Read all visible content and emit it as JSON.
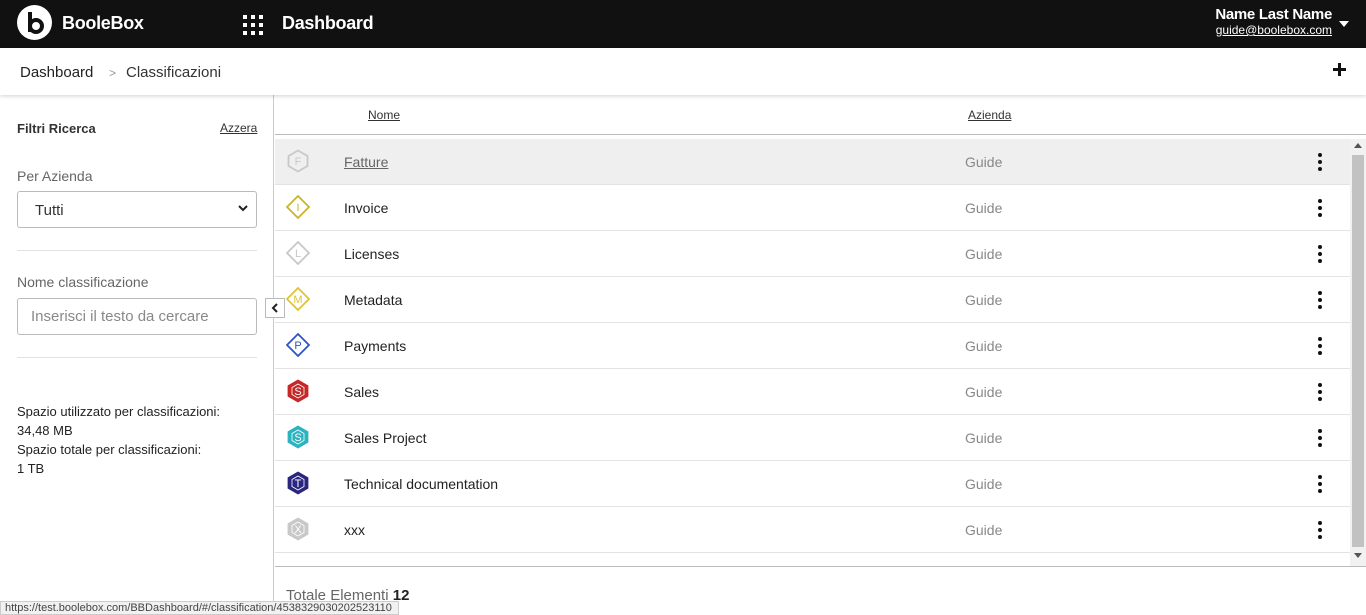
{
  "header": {
    "brand": "BooleBox",
    "title": "Dashboard",
    "user_name": "Name Last Name",
    "user_email": "guide@boolebox.com"
  },
  "breadcrumb": {
    "items": [
      "Dashboard",
      "Classificazioni"
    ],
    "separator": ">"
  },
  "filters": {
    "title": "Filtri Ricerca",
    "reset_label": "Azzera",
    "company_label": "Per Azienda",
    "company_value": "Tutti",
    "name_label": "Nome classificazione",
    "name_placeholder": "Inserisci il testo da cercare",
    "space_used_label": "Spazio utilizzato per classificazioni:",
    "space_used_value": "34,48 MB",
    "space_total_label": "Spazio totale per classificazioni:",
    "space_total_value": "1 TB"
  },
  "table": {
    "columns": [
      "Nome",
      "Azienda"
    ],
    "rows": [
      {
        "letter": "F",
        "name": "Fatture",
        "company": "Guide",
        "shape": "hexagon",
        "color": "#c8c8c8",
        "filled": false
      },
      {
        "letter": "I",
        "name": "Invoice",
        "company": "Guide",
        "shape": "diamond",
        "color": "#c9b52a",
        "filled": false
      },
      {
        "letter": "L",
        "name": "Licenses",
        "company": "Guide",
        "shape": "diamond",
        "color": "#c8c8c8",
        "filled": false
      },
      {
        "letter": "M",
        "name": "Metadata",
        "company": "Guide",
        "shape": "diamond",
        "color": "#e0c233",
        "filled": false
      },
      {
        "letter": "P",
        "name": "Payments",
        "company": "Guide",
        "shape": "diamond",
        "color": "#2a55c8",
        "filled": false
      },
      {
        "letter": "S",
        "name": "Sales",
        "company": "Guide",
        "shape": "hexagon",
        "color": "#c62828",
        "filled": true
      },
      {
        "letter": "S",
        "name": "Sales Project",
        "company": "Guide",
        "shape": "hexagon",
        "color": "#2bb3c0",
        "filled": true
      },
      {
        "letter": "T",
        "name": "Technical documentation",
        "company": "Guide",
        "shape": "hexagon",
        "color": "#2a2680",
        "filled": true
      },
      {
        "letter": "X",
        "name": "xxx",
        "company": "Guide",
        "shape": "hexagon",
        "color": "#c8c8c8",
        "filled": true
      }
    ],
    "total_label": "Totale Elementi",
    "total_count": "12"
  },
  "status_url": "https://test.boolebox.com/BBDashboard/#/classification/4538329030202523110"
}
